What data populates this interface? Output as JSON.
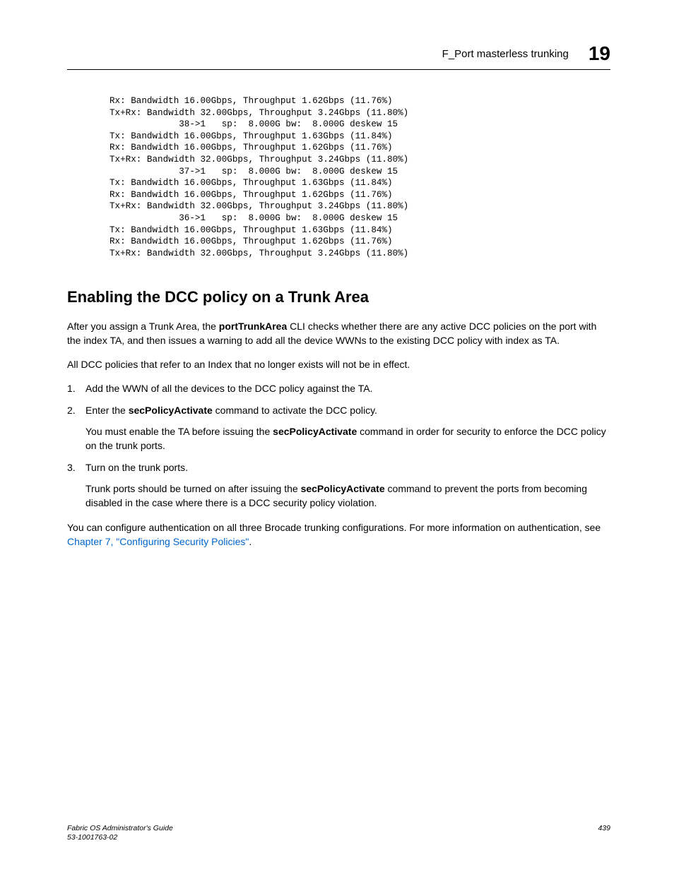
{
  "header": {
    "title": "F_Port masterless trunking",
    "chapter": "19"
  },
  "code_block": "Rx: Bandwidth 16.00Gbps, Throughput 1.62Gbps (11.76%)\nTx+Rx: Bandwidth 32.00Gbps, Throughput 3.24Gbps (11.80%)\n             38->1   sp:  8.000G bw:  8.000G deskew 15\nTx: Bandwidth 16.00Gbps, Throughput 1.63Gbps (11.84%)\nRx: Bandwidth 16.00Gbps, Throughput 1.62Gbps (11.76%)\nTx+Rx: Bandwidth 32.00Gbps, Throughput 3.24Gbps (11.80%)\n             37->1   sp:  8.000G bw:  8.000G deskew 15\nTx: Bandwidth 16.00Gbps, Throughput 1.63Gbps (11.84%)\nRx: Bandwidth 16.00Gbps, Throughput 1.62Gbps (11.76%)\nTx+Rx: Bandwidth 32.00Gbps, Throughput 3.24Gbps (11.80%)\n             36->1   sp:  8.000G bw:  8.000G deskew 15\nTx: Bandwidth 16.00Gbps, Throughput 1.63Gbps (11.84%)\nRx: Bandwidth 16.00Gbps, Throughput 1.62Gbps (11.76%)\nTx+Rx: Bandwidth 32.00Gbps, Throughput 3.24Gbps (11.80%)",
  "section_heading": "Enabling the DCC policy on a Trunk Area",
  "para1_a": "After you assign a Trunk Area, the ",
  "para1_cmd": "portTrunkArea",
  "para1_b": " CLI checks whether there are any active DCC policies on the port with the index TA, and then issues a warning to add all the device WWNs to the existing DCC policy with index as TA.",
  "para2": "All DCC policies that refer to an Index that no longer exists will not be in effect.",
  "list": {
    "n1": "1.",
    "item1": "Add the WWN of all the devices to the DCC policy against the TA.",
    "n2": "2.",
    "item2_a": "Enter the ",
    "item2_cmd": "secPolicyActivate",
    "item2_b": " command to activate the DCC policy.",
    "item2_sub_a": "You must enable the TA before issuing the ",
    "item2_sub_cmd": "secPolicyActivate",
    "item2_sub_b": " command in order for security to enforce the DCC policy on the trunk ports.",
    "n3": "3.",
    "item3": "Turn on the trunk ports.",
    "item3_sub_a": "Trunk ports should be turned on after issuing the ",
    "item3_sub_cmd": "secPolicyActivate",
    "item3_sub_b": " command to prevent the ports from becoming disabled in the case where there is a DCC security policy violation."
  },
  "para3_a": "You can configure authentication on all three Brocade trunking configurations. For more information on authentication, see ",
  "para3_link": "Chapter 7, \"Configuring Security Policies\"",
  "para3_b": ".",
  "footer": {
    "line1": "Fabric OS Administrator's Guide",
    "line2": "53-1001763-02",
    "pagenum": "439"
  }
}
